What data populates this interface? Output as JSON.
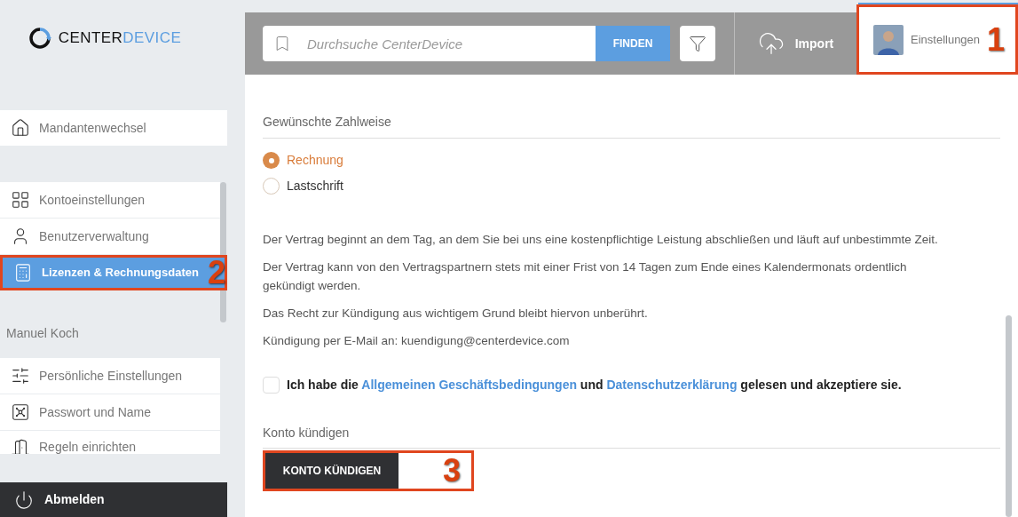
{
  "logo": {
    "main": "CENTER",
    "accent": "DEVICE"
  },
  "sidebar": {
    "groups": [
      {
        "items": [
          {
            "label": "Mandantenwechsel",
            "kind": "home",
            "selected": false
          }
        ]
      },
      {
        "items": [
          {
            "label": "Kontoeinstellungen",
            "kind": "grid",
            "selected": false
          },
          {
            "label": "Benutzerverwaltung",
            "kind": "user",
            "selected": false
          },
          {
            "label": "Lizenzen & Rechnungsdaten",
            "kind": "calculator",
            "selected": true,
            "callout": "2"
          }
        ]
      },
      {
        "heading": "Manuel Koch",
        "items": [
          {
            "label": "Persönliche Einstellungen",
            "kind": "sliders",
            "selected": false
          },
          {
            "label": "Passwort und Name",
            "kind": "vault",
            "selected": false
          },
          {
            "label": "Regeln einrichten",
            "kind": "door",
            "selected": false
          }
        ]
      }
    ],
    "logout": "Abmelden"
  },
  "header": {
    "search": {
      "placeholder": "Durchsuche CenterDevice",
      "button": "FINDEN"
    },
    "import": "Import",
    "settings": {
      "label": "Einstellungen",
      "callout": "1"
    }
  },
  "payment": {
    "heading": "Gewünschte Zahlweise",
    "options": [
      {
        "label": "Rechnung",
        "selected": true
      },
      {
        "label": "Lastschrift",
        "selected": false
      }
    ]
  },
  "terms": [
    "Der Vertrag beginnt an dem Tag, an dem Sie bei uns eine kostenpflichtige Leistung abschließen und läuft auf unbestimmte Zeit.",
    "Der Vertrag kann von den Vertragspartnern stets mit einer Frist von 14 Tagen zum Ende eines Kalendermonats ordentlich gekündigt werden.",
    "Das Recht zur Kündigung aus wichtigem Grund bleibt hiervon unberührt.",
    "Kündigung per E-Mail an: kuendigung@centerdevice.com"
  ],
  "consent": {
    "checked": false,
    "parts": [
      {
        "kind": "text",
        "text": "Ich habe die "
      },
      {
        "kind": "link",
        "text": "Allgemeinen Geschäftsbedingungen"
      },
      {
        "kind": "text",
        "text": " und "
      },
      {
        "kind": "link",
        "text": "Datenschutzerklärung"
      },
      {
        "kind": "text",
        "text": " gelesen und akzeptiere sie."
      }
    ]
  },
  "cancel": {
    "heading": "Konto kündigen",
    "button": "KONTO KÜNDIGEN",
    "callout": "3"
  }
}
